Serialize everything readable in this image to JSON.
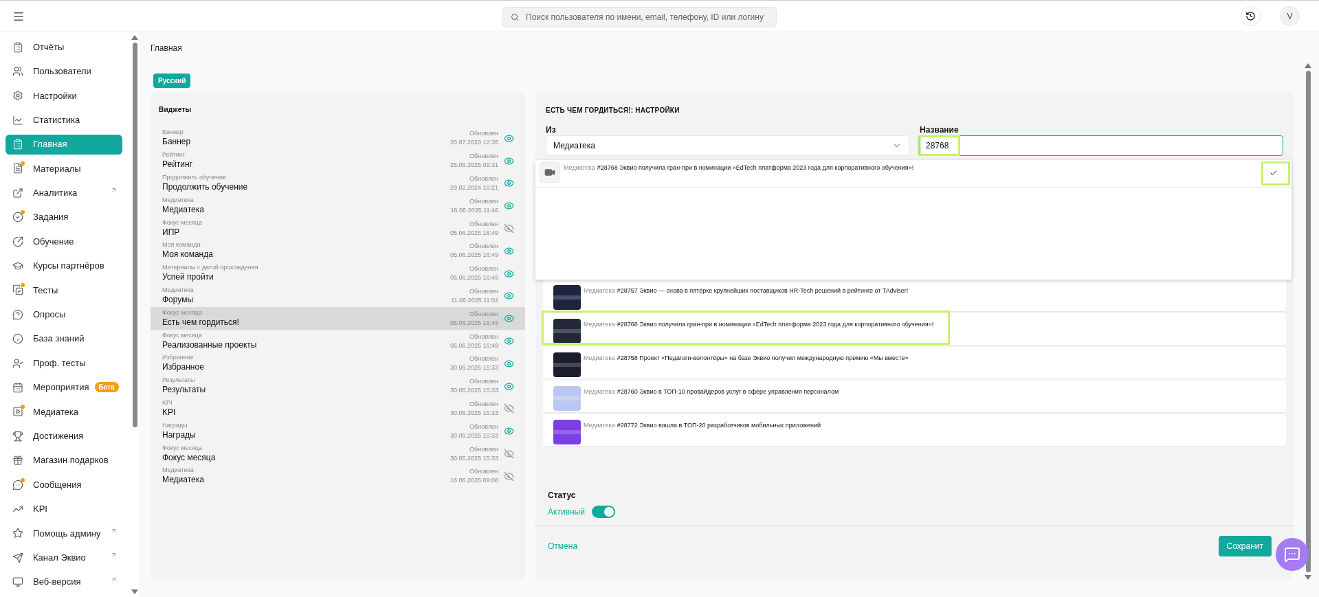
{
  "top_bar": {
    "search": {
      "placeholder": "Поиск пользователя по имени, email, телефону, ID или логину"
    },
    "avatar": "V"
  },
  "sidebar": {
    "items": [
      {
        "label": "Отчёты",
        "selected": false,
        "dot": false,
        "external": false
      },
      {
        "label": "Пользователи",
        "selected": false,
        "dot": false,
        "external": false
      },
      {
        "label": "Настройки",
        "selected": false,
        "dot": false,
        "external": false
      },
      {
        "label": "Статистика",
        "selected": false,
        "dot": false,
        "external": false
      },
      {
        "label": "Главная",
        "selected": true,
        "dot": false,
        "external": false
      },
      {
        "label": "Материалы",
        "selected": false,
        "dot": true,
        "external": false
      },
      {
        "label": "Аналитика",
        "selected": false,
        "dot": false,
        "external": true
      },
      {
        "label": "Задания",
        "selected": false,
        "dot": true,
        "external": false
      },
      {
        "label": "Обучение",
        "selected": false,
        "dot": false,
        "external": false
      },
      {
        "label": "Курсы партнёров",
        "selected": false,
        "dot": false,
        "external": false
      },
      {
        "label": "Тесты",
        "selected": false,
        "dot": true,
        "external": false
      },
      {
        "label": "Опросы",
        "selected": false,
        "dot": false,
        "external": false
      },
      {
        "label": "База знаний",
        "selected": false,
        "dot": false,
        "external": false
      },
      {
        "label": "Проф. тесты",
        "selected": false,
        "dot": false,
        "external": false
      },
      {
        "label": "Мероприятия",
        "selected": false,
        "dot": false,
        "external": false,
        "badge": "Бета"
      },
      {
        "label": "Медиатека",
        "selected": false,
        "dot": true,
        "external": false
      },
      {
        "label": "Достижения",
        "selected": false,
        "dot": false,
        "external": false
      },
      {
        "label": "Магазин подарков",
        "selected": false,
        "dot": false,
        "external": false
      },
      {
        "label": "Сообщения",
        "selected": false,
        "dot": true,
        "external": false
      },
      {
        "label": "KPI",
        "selected": false,
        "dot": false,
        "external": false
      },
      {
        "label": "Помощь админу",
        "selected": false,
        "dot": false,
        "external": true
      },
      {
        "label": "Канал Эквио",
        "selected": false,
        "dot": false,
        "external": true
      },
      {
        "label": "Веб-версия",
        "selected": false,
        "dot": false,
        "external": true
      }
    ]
  },
  "breadcrumb": "Главная",
  "language_badge": "Русский",
  "widgets": {
    "title": "Виджеты",
    "items": [
      {
        "category": "Баннер",
        "title": "Баннер",
        "updated_label": "Обновлен",
        "date": "20.07.2023 12:35",
        "visible": true,
        "selected": false
      },
      {
        "category": "Рейтинг",
        "title": "Рейтинг",
        "updated_label": "Обновлен",
        "date": "25.06.2025 09:31",
        "visible": true,
        "selected": false
      },
      {
        "category": "Продолжить обучение",
        "title": "Продолжить обучение",
        "updated_label": "Обновлен",
        "date": "29.02.2024 16:21",
        "visible": true,
        "selected": false
      },
      {
        "category": "Медиатека",
        "title": "Медиатека",
        "updated_label": "Обновлен",
        "date": "16.06.2025 11:46",
        "visible": true,
        "selected": false
      },
      {
        "category": "Фокус месяца",
        "title": "ИПР",
        "updated_label": "Обновлен",
        "date": "05.06.2025 16:49",
        "visible": false,
        "selected": false
      },
      {
        "category": "Моя команда",
        "title": "Моя команда",
        "updated_label": "Обновлен",
        "date": "05.06.2025 16:49",
        "visible": true,
        "selected": false
      },
      {
        "category": "Материалы с датой прохождения",
        "title": "Успей пройти",
        "updated_label": "Обновлен",
        "date": "05.06.2025 16:49",
        "visible": true,
        "selected": false
      },
      {
        "category": "Медиатека",
        "title": "Форумы",
        "updated_label": "Обновлен",
        "date": "11.06.2025 11:02",
        "visible": true,
        "selected": false
      },
      {
        "category": "Фокус месяца",
        "title": "Есть чем гордиться!",
        "updated_label": "Обновлен",
        "date": "05.06.2025 16:49",
        "visible": true,
        "selected": true
      },
      {
        "category": "Фокус месяца",
        "title": "Реализованные проекты",
        "updated_label": "Обновлен",
        "date": "05.06.2025 16:49",
        "visible": true,
        "selected": false
      },
      {
        "category": "Избранное",
        "title": "Избранное",
        "updated_label": "Обновлен",
        "date": "30.05.2025 15:33",
        "visible": true,
        "selected": false
      },
      {
        "category": "Результаты",
        "title": "Результаты",
        "updated_label": "Обновлен",
        "date": "30.05.2025 15:33",
        "visible": true,
        "selected": false
      },
      {
        "category": "KPI",
        "title": "KPI",
        "updated_label": "Обновлен",
        "date": "30.05.2025 15:33",
        "visible": false,
        "selected": false
      },
      {
        "category": "Награды",
        "title": "Награды",
        "updated_label": "Обновлен",
        "date": "30.05.2025 15:33",
        "visible": true,
        "selected": false
      },
      {
        "category": "Фокус месяца",
        "title": "Фокус месяца",
        "updated_label": "Обновлен",
        "date": "30.05.2025 15:33",
        "visible": false,
        "selected": false
      },
      {
        "category": "Медиатека",
        "title": "Медиатека",
        "updated_label": "Обновлен",
        "date": "16.06.2025 09:08",
        "visible": false,
        "selected": false
      }
    ]
  },
  "settings": {
    "title": "ЕСТЬ ЧЕМ ГОРДИТЬСЯ!: НАСТРОЙКИ",
    "source": {
      "label": "Из",
      "value": "Медиатека"
    },
    "name": {
      "label": "Название",
      "value": "28768",
      "highlighted": true
    },
    "search_result": {
      "source": "Медиатека",
      "text": "#28768 Эквио получила гран-при в номинации «EdTech платформа 2023 года для корпоративного обучения»!",
      "checked": true,
      "highlighted": true
    },
    "materials": [
      {
        "source": "Медиатека",
        "text": "#28757 Эквио — снова в пятёрке крупнейших поставщиков HR-Tech решений в рейтинге от TAdviser!",
        "color": "#1e2440",
        "highlighted": false
      },
      {
        "source": "Медиатека",
        "text": "#28768 Эквио получила гран-при в номинации «EdTech платформа 2023 года для корпоративного обучения»!",
        "color": "#23283a",
        "highlighted": true
      },
      {
        "source": "Медиатека",
        "text": "#28758 Проект «Педагоги-волонтёры» на базе Эквио получил международную премию «Мы вместе»",
        "color": "#1a1d2b",
        "highlighted": false
      },
      {
        "source": "Медиатека",
        "text": "#28760 Эквио в ТОП-10 провайдеров услуг в сфере управления персоналом",
        "color": "#b9c8f0",
        "highlighted": false
      },
      {
        "source": "Медиатека",
        "text": "#28772 Эквио вошла в ТОП-20 разработчиков мобильных приложений",
        "color": "#7b3fe4",
        "highlighted": false
      }
    ],
    "status": {
      "label": "Статус",
      "value_label": "Активный",
      "on": true
    },
    "cancel": "Отмена",
    "save": "Сохранит"
  }
}
